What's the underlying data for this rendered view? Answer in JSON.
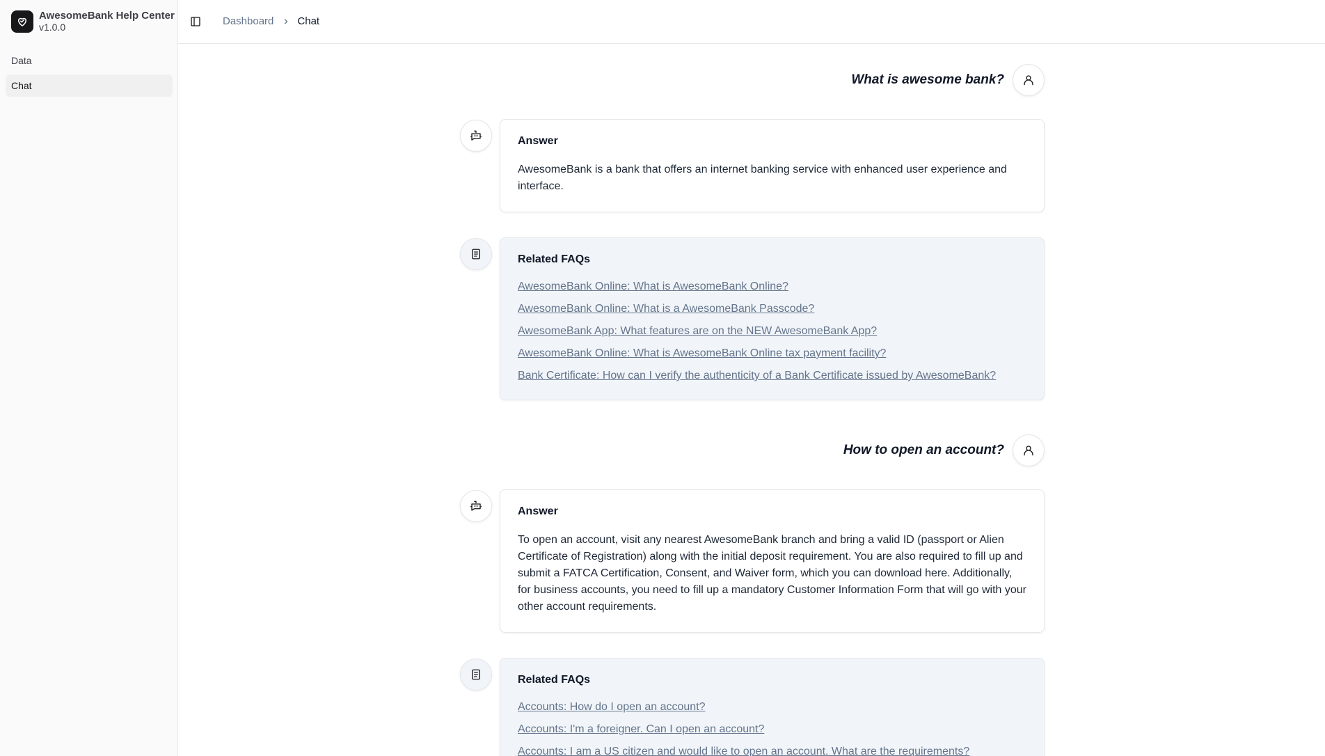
{
  "app": {
    "name": "AwesomeBank Help Center",
    "version": "v1.0.0"
  },
  "sidebar": {
    "items": [
      {
        "label": "Data"
      },
      {
        "label": "Chat"
      }
    ]
  },
  "breadcrumb": {
    "parent": "Dashboard",
    "current": "Chat"
  },
  "conversation": [
    {
      "question": "What is awesome bank?",
      "answer_title": "Answer",
      "answer": "AwesomeBank is a bank that offers an internet banking service with enhanced user experience and interface.",
      "faq_title": "Related FAQs",
      "faqs": [
        "AwesomeBank Online: What is AwesomeBank Online?",
        "AwesomeBank Online: What is a AwesomeBank Passcode?",
        "AwesomeBank App: What features are on the NEW AwesomeBank App?",
        "AwesomeBank Online: What is AwesomeBank Online tax payment facility?",
        "Bank Certificate: How can I verify the authenticity of a Bank Certificate issued by AwesomeBank?"
      ]
    },
    {
      "question": "How to open an account?",
      "answer_title": "Answer",
      "answer": "To open an account, visit any nearest AwesomeBank branch and bring a valid ID (passport or Alien Certificate of Registration) along with the initial deposit requirement. You are also required to fill up and submit a FATCA Certification, Consent, and Waiver form, which you can download here. Additionally, for business accounts, you need to fill up a mandatory Customer Information Form that will go with your other account requirements.",
      "faq_title": "Related FAQs",
      "faqs": [
        "Accounts: How do I open an account?",
        "Accounts: I'm a foreigner. Can I open an account?",
        "Accounts: I am a US citizen and would like to open an account. What are the requirements?"
      ]
    }
  ]
}
